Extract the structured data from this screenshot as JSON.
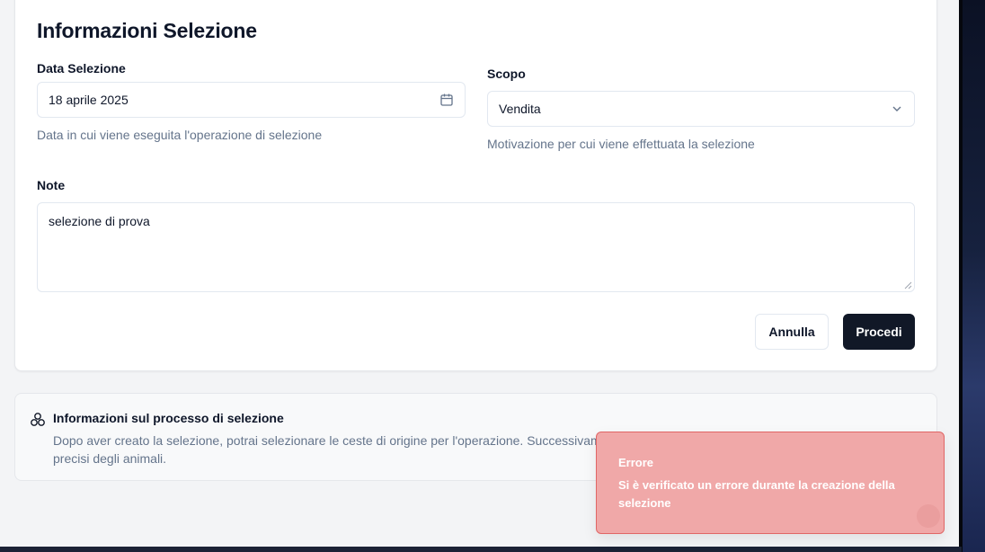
{
  "form": {
    "title": "Informazioni Selezione",
    "date_label": "Data Selezione",
    "date_value": "18 aprile 2025",
    "date_hint": "Data in cui viene eseguita l'operazione di selezione",
    "purpose_label": "Scopo",
    "purpose_value": "Vendita",
    "purpose_hint": "Motivazione per cui viene effettuata la selezione",
    "notes_label": "Note",
    "notes_value": "selezione di prova",
    "cancel_label": "Annulla",
    "proceed_label": "Procedi"
  },
  "info": {
    "title": "Informazioni sul processo di selezione",
    "text": "Dopo aver creato la selezione, potrai selezionare le ceste di origine per l'operazione. Successivame",
    "text_line2": "precisi degli animali."
  },
  "toast": {
    "title": "Errore",
    "message": "Si è verificato un errore durante la creazione della selezione"
  },
  "icons": {
    "date": "calendar-icon",
    "purpose": "chevron-down-icon",
    "info": "cluster-icon"
  },
  "colors": {
    "primary_button": "#111827",
    "toast_bg": "#f0a8a8",
    "toast_border": "#e06666",
    "hint_text": "#64748b"
  }
}
